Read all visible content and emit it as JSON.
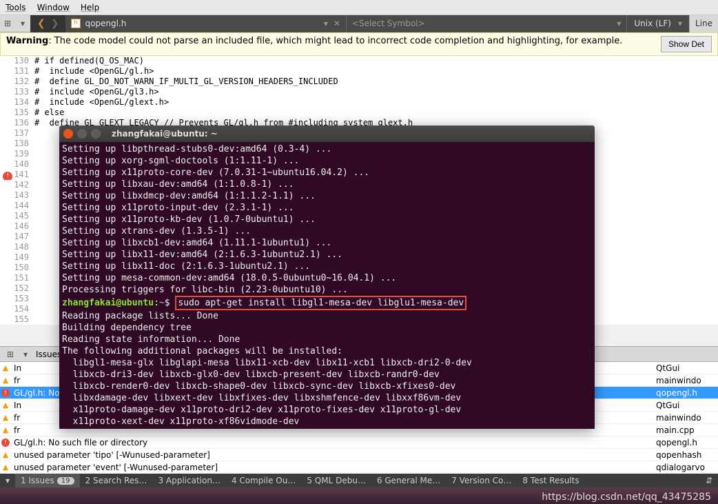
{
  "menubar": {
    "tools": "Tools",
    "window": "Window",
    "help": "Help"
  },
  "toolbar": {
    "file_name": "qopengl.h",
    "symbol_placeholder": "<Select Symbol>",
    "encoding": "Unix (LF)",
    "line_label": "Line"
  },
  "warning": {
    "label": "Warning",
    "text": ": The code model could not parse an included file, which might lead to incorrect code completion and highlighting, for example.",
    "button": "Show Det"
  },
  "code": {
    "lines": [
      {
        "n": "130",
        "t": "# if defined(Q_OS_MAC)"
      },
      {
        "n": "131",
        "t": "#  include <OpenGL/gl.h>"
      },
      {
        "n": "132",
        "t": "#  define GL_DO_NOT_WARN_IF_MULTI_GL_VERSION_HEADERS_INCLUDED"
      },
      {
        "n": "133",
        "t": "#  include <OpenGL/gl3.h>"
      },
      {
        "n": "134",
        "t": "#  include <OpenGL/glext.h>"
      },
      {
        "n": "135",
        "t": "# else"
      },
      {
        "n": "136",
        "t": "#  define GL_GLEXT_LEGACY // Prevents GL/gl.h from #including system glext.h"
      },
      {
        "n": "137",
        "t": ""
      },
      {
        "n": "138",
        "t": ""
      },
      {
        "n": "139",
        "t": ""
      },
      {
        "n": "140",
        "t": ""
      },
      {
        "n": "141",
        "t": "",
        "err": true
      },
      {
        "n": "142",
        "t": ""
      },
      {
        "n": "143",
        "t": ""
      },
      {
        "n": "144",
        "t": ""
      },
      {
        "n": "145",
        "t": ""
      },
      {
        "n": "146",
        "t": ""
      },
      {
        "n": "147",
        "t": ""
      },
      {
        "n": "148",
        "t": ""
      },
      {
        "n": "149",
        "t": ""
      },
      {
        "n": "150",
        "t": ""
      },
      {
        "n": "151",
        "t": ""
      },
      {
        "n": "152",
        "t": ""
      },
      {
        "n": "153",
        "t": ""
      },
      {
        "n": "154",
        "t": ""
      },
      {
        "n": "155",
        "t": ""
      }
    ]
  },
  "issues_header": "Issues",
  "terminal": {
    "title": "zhangfakai@ubuntu: ~",
    "lines": [
      "Setting up libpthread-stubs0-dev:amd64 (0.3-4) ...",
      "Setting up xorg-sgml-doctools (1:1.11-1) ...",
      "Setting up x11proto-core-dev (7.0.31-1~ubuntu16.04.2) ...",
      "Setting up libxau-dev:amd64 (1:1.0.8-1) ...",
      "Setting up libxdmcp-dev:amd64 (1:1.1.2-1.1) ...",
      "Setting up x11proto-input-dev (2.3.1-1) ...",
      "Setting up x11proto-kb-dev (1.0.7-0ubuntu1) ...",
      "Setting up xtrans-dev (1.3.5-1) ...",
      "Setting up libxcb1-dev:amd64 (1.11.1-1ubuntu1) ...",
      "Setting up libx11-dev:amd64 (2:1.6.3-1ubuntu2.1) ...",
      "Setting up libx11-doc (2:1.6.3-1ubuntu2.1) ...",
      "Setting up mesa-common-dev:amd64 (18.0.5-0ubuntu0~16.04.1) ...",
      "Processing triggers for libc-bin (2.23-0ubuntu10) ..."
    ],
    "prompt_user": "zhangfakai@ubuntu",
    "prompt_path": "~",
    "prompt_sep": ":",
    "prompt_dollar": "$",
    "cmd": "sudo apt-get install libgl1-mesa-dev libglu1-mesa-dev",
    "after": [
      "Reading package lists... Done",
      "Building dependency tree       ",
      "Reading state information... Done",
      "The following additional packages will be installed:",
      "  libgl1-mesa-glx libglapi-mesa libx11-xcb-dev libx11-xcb1 libxcb-dri2-0-dev",
      "  libxcb-dri3-dev libxcb-glx0-dev libxcb-present-dev libxcb-randr0-dev",
      "  libxcb-render0-dev libxcb-shape0-dev libxcb-sync-dev libxcb-xfixes0-dev",
      "  libxdamage-dev libxext-dev libxfixes-dev libxshmfence-dev libxxf86vm-dev",
      "  x11proto-damage-dev x11proto-dri2-dev x11proto-fixes-dev x11proto-gl-dev",
      "  x11proto-xext-dev x11proto-xf86vidmode-dev"
    ]
  },
  "issues": [
    {
      "type": "warn",
      "desc": "In",
      "file": "QtGui"
    },
    {
      "type": "warn",
      "desc": "fr",
      "file": "mainwindo"
    },
    {
      "type": "err",
      "desc": "GL/gl.h: No such file or directory",
      "file": "qopengl.h",
      "sel": true,
      "sub": "/h"
    },
    {
      "type": "warn",
      "desc": "In",
      "file": "QtGui"
    },
    {
      "type": "warn",
      "desc": "fr",
      "file": "mainwindo"
    },
    {
      "type": "warn",
      "desc": "fr",
      "file": "main.cpp"
    },
    {
      "type": "err",
      "desc": "GL/gl.h: No such file or directory",
      "file": "qopengl.h"
    },
    {
      "type": "warn",
      "desc": "unused parameter 'tipo' [-Wunused-parameter]",
      "file": "qopenhash"
    },
    {
      "type": "warn",
      "desc": "unused parameter 'event' [-Wunused-parameter]",
      "file": "qdialogarvo"
    }
  ],
  "bottom_tabs": [
    {
      "n": "1",
      "label": "Issues",
      "badge": "19"
    },
    {
      "n": "2",
      "label": "Search Res…"
    },
    {
      "n": "3",
      "label": "Application…"
    },
    {
      "n": "4",
      "label": "Compile Ou…"
    },
    {
      "n": "5",
      "label": "QML Debu…"
    },
    {
      "n": "6",
      "label": "General Me…"
    },
    {
      "n": "7",
      "label": "Version Co…"
    },
    {
      "n": "8",
      "label": "Test Results"
    }
  ],
  "watermark": "https://blog.csdn.net/qq_43475285"
}
